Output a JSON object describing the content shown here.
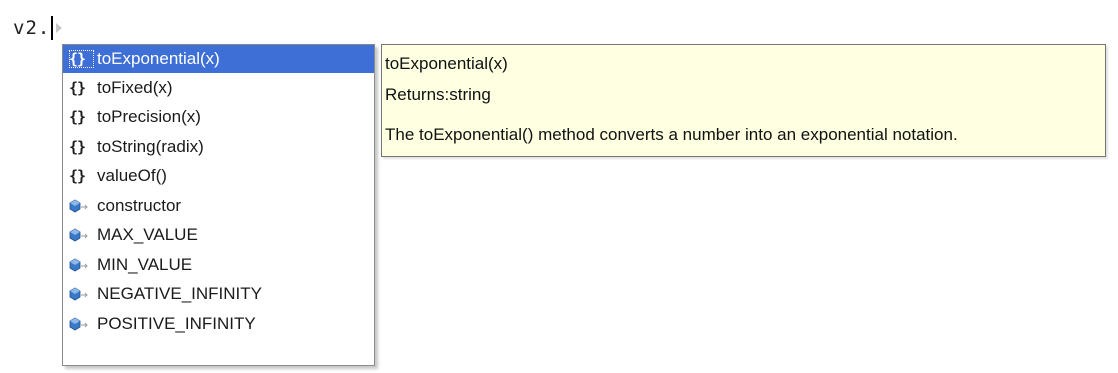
{
  "editor": {
    "code_text": "v2."
  },
  "completion": {
    "selected_index": 0,
    "items": [
      {
        "kind": "method",
        "icon": "{}",
        "label": "toExponential(x)"
      },
      {
        "kind": "method",
        "icon": "{}",
        "label": "toFixed(x)"
      },
      {
        "kind": "method",
        "icon": "{}",
        "label": "toPrecision(x)"
      },
      {
        "kind": "method",
        "icon": "{}",
        "label": "toString(radix)"
      },
      {
        "kind": "method",
        "icon": "{}",
        "label": "valueOf()"
      },
      {
        "kind": "property",
        "icon": "property-icon",
        "label": "constructor"
      },
      {
        "kind": "property",
        "icon": "property-icon",
        "label": "MAX_VALUE"
      },
      {
        "kind": "property",
        "icon": "property-icon",
        "label": "MIN_VALUE"
      },
      {
        "kind": "property",
        "icon": "property-icon",
        "label": "NEGATIVE_INFINITY"
      },
      {
        "kind": "property",
        "icon": "property-icon",
        "label": "POSITIVE_INFINITY"
      }
    ]
  },
  "tooltip": {
    "signature": "toExponential(x)",
    "returns": "Returns:string",
    "description": "The toExponential() method converts a number into an exponential notation."
  },
  "colors": {
    "selection": "#3d6fd6",
    "tooltip_bg": "#ffffe1",
    "property_icon": "#3a78c8"
  }
}
